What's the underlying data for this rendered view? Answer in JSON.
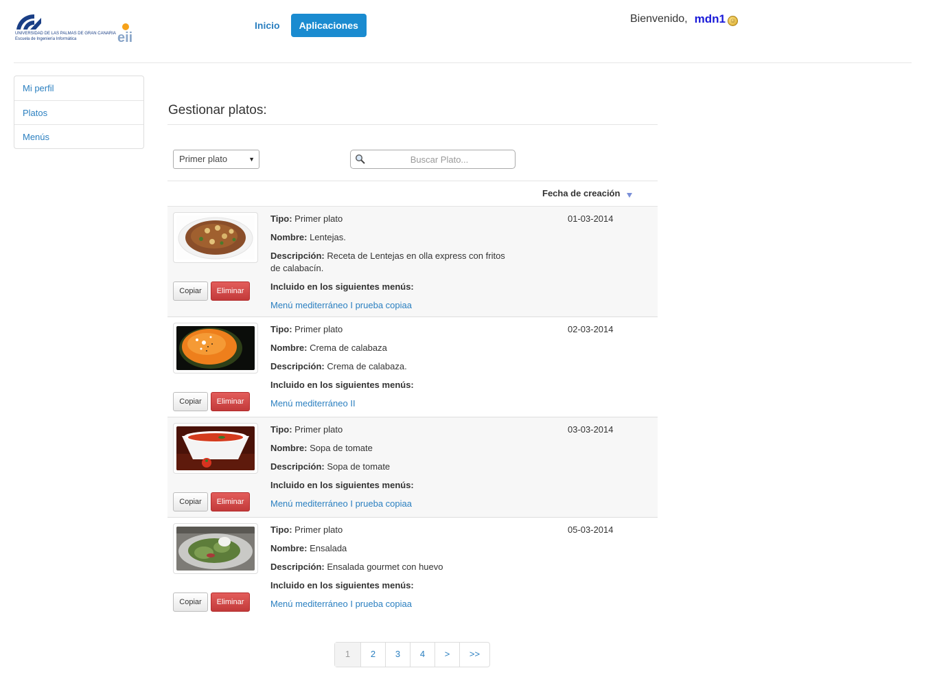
{
  "logo": {
    "university": "UNIVERSIDAD DE LAS PALMAS DE GRAN CANARIA",
    "school": "Escuela de Ingeniería Informática"
  },
  "nav": {
    "home": "Inicio",
    "apps": "Aplicaciones"
  },
  "user": {
    "welcome": "Bienvenido,",
    "name": "mdn1"
  },
  "sidebar": {
    "items": [
      {
        "label": "Mi perfil"
      },
      {
        "label": "Platos"
      },
      {
        "label": "Menús"
      }
    ]
  },
  "main": {
    "title": "Gestionar platos:",
    "filter_selected": "Primer plato",
    "search_placeholder": "Buscar Plato...",
    "col_date": "Fecha de creación"
  },
  "labels": {
    "tipo": "Tipo:",
    "nombre": "Nombre:",
    "descripcion": "Descripción:",
    "incluido": "Incluido en los siguientes menús:",
    "copy": "Copiar",
    "delete": "Eliminar"
  },
  "dishes": [
    {
      "tipo": "Primer plato",
      "nombre": "Lentejas.",
      "descripcion": "Receta de Lentejas en olla express con fritos de calabacín.",
      "menus": "Menú mediterráneo I prueba copiaa",
      "fecha": "01-03-2014",
      "image_icon": "lentils-photo"
    },
    {
      "tipo": "Primer plato",
      "nombre": "Crema de calabaza",
      "descripcion": "Crema de calabaza.",
      "menus": "Menú mediterráneo II",
      "fecha": "02-03-2014",
      "image_icon": "pumpkin-cream-photo"
    },
    {
      "tipo": "Primer plato",
      "nombre": "Sopa de tomate",
      "descripcion": "Sopa de tomate",
      "menus": "Menú mediterráneo I prueba copiaa",
      "fecha": "03-03-2014",
      "image_icon": "tomato-soup-photo"
    },
    {
      "tipo": "Primer plato",
      "nombre": "Ensalada",
      "descripcion": "Ensalada gourmet con huevo",
      "menus": "Menú mediterráneo I prueba copiaa",
      "fecha": "05-03-2014",
      "image_icon": "salad-photo"
    }
  ],
  "pagination": {
    "pages": [
      "1",
      "2",
      "3",
      "4",
      ">",
      ">>"
    ],
    "current": "1"
  },
  "colors": {
    "link": "#2a7fc0",
    "primary": "#1a8bd0",
    "danger": "#c23a3a"
  }
}
